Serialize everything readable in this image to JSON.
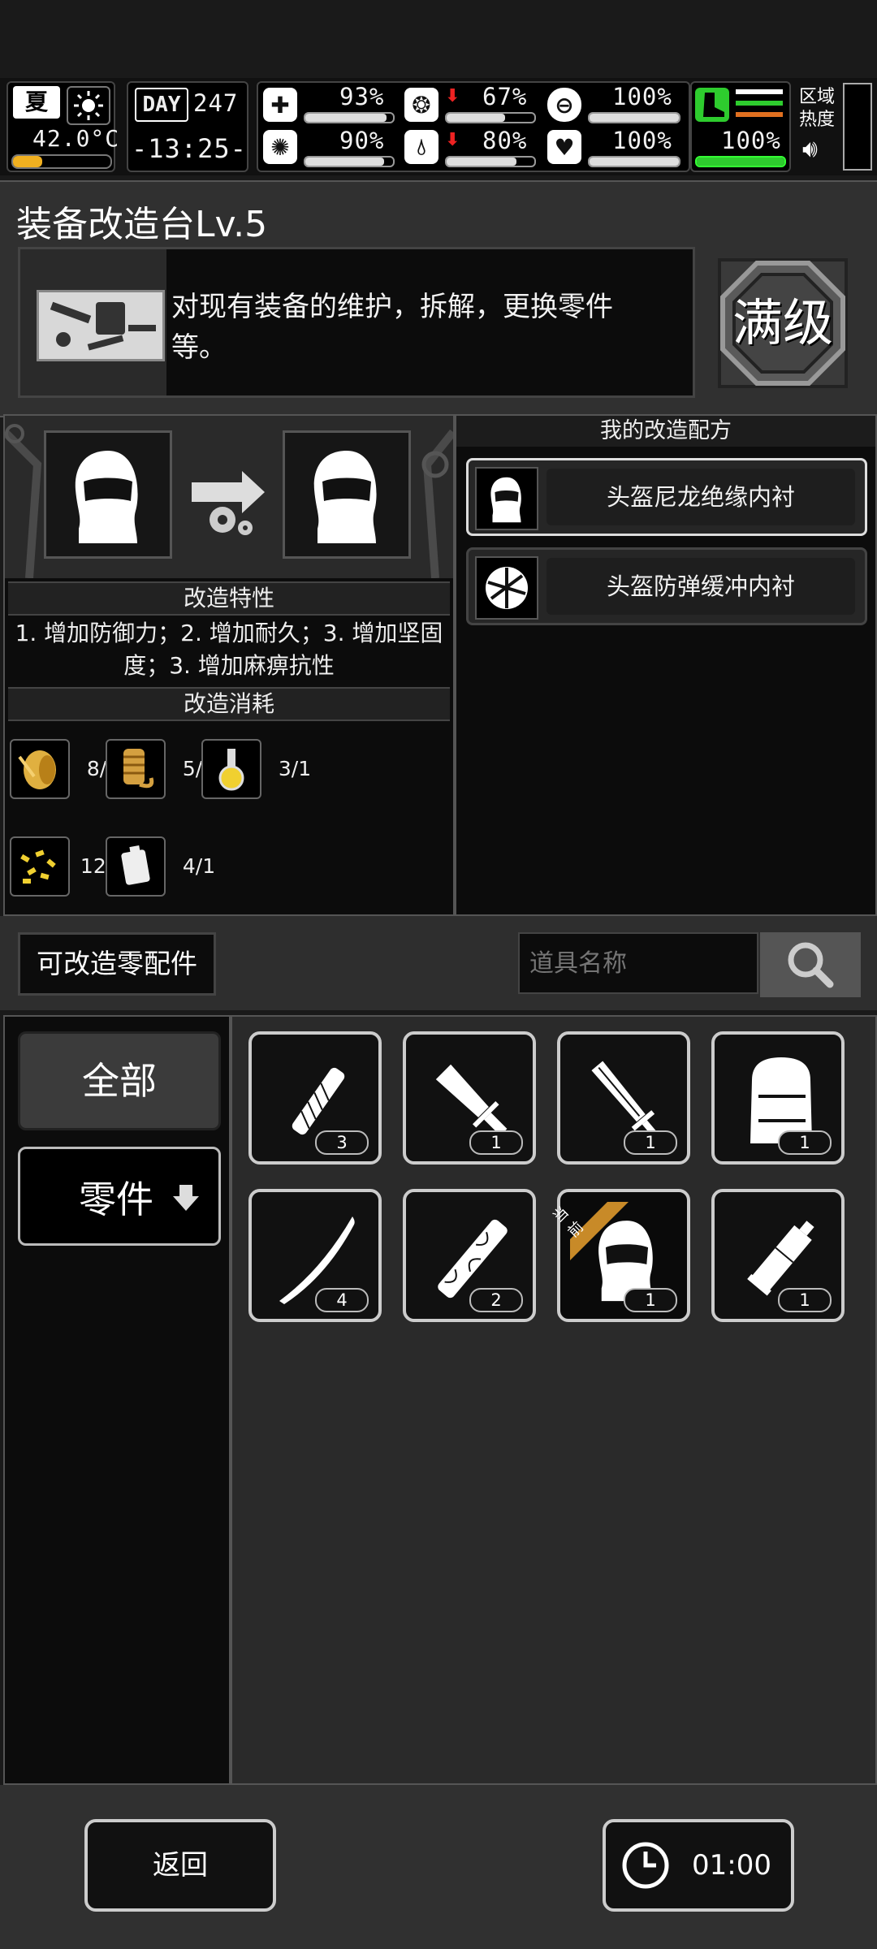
{
  "status": {
    "season": "夏",
    "temperature": "42.0°C",
    "day_label": "DAY",
    "day_number": "247",
    "clock": "-13:25-",
    "stats": [
      {
        "name": "health",
        "value": "93%",
        "level": 0.93,
        "down": false
      },
      {
        "name": "stomach",
        "value": "67%",
        "level": 0.67,
        "down": true
      },
      {
        "name": "helmet",
        "value": "100%",
        "level": 1.0,
        "down": false
      },
      {
        "name": "brain",
        "value": "90%",
        "level": 0.9,
        "down": false
      },
      {
        "name": "water",
        "value": "80%",
        "level": 0.8,
        "down": true
      },
      {
        "name": "heart",
        "value": "100%",
        "level": 1.0,
        "down": false
      }
    ],
    "stamina": {
      "value": "100%",
      "level": 1.0
    },
    "zone_label": "区域热度",
    "colors": {
      "stamina": "#2ecc2e",
      "warning": "#ee2222",
      "orange": "#e07020"
    }
  },
  "station": {
    "title": "装备改造台Lv.5",
    "description": "对现有装备的维护，拆解，更换零件等。",
    "max_level": "满级"
  },
  "mod": {
    "props_title": "改造特性",
    "props_text": "1. 增加防御力；2. 增加耐久；3. 增加坚固度；3. 增加麻痹抗性",
    "cost_title": "改造消耗",
    "materials": [
      {
        "icon": "wire-spool-icon",
        "count": "8/1"
      },
      {
        "icon": "rope-coil-icon",
        "count": "5/1"
      },
      {
        "icon": "chemical-flask-icon",
        "count": "3/1"
      },
      {
        "icon": "gold-nuggets-icon",
        "count": "12/1"
      },
      {
        "icon": "battery-icon",
        "count": "4/1"
      }
    ]
  },
  "recipes": {
    "title": "我的改造配方",
    "items": [
      {
        "label": "头盔尼龙绝缘内衬",
        "icon": "balaclava-icon",
        "selected": true
      },
      {
        "label": "头盔防弹缓冲内衬",
        "icon": "padded-lining-icon",
        "selected": false
      }
    ]
  },
  "parts": {
    "label": "可改造零配件",
    "search_placeholder": "道具名称"
  },
  "categories": {
    "all": "全部",
    "parts": "零件"
  },
  "inventory": [
    {
      "icon": "wrapped-handle-icon",
      "qty": "3"
    },
    {
      "icon": "machete-icon",
      "qty": "1"
    },
    {
      "icon": "serrated-blade-icon",
      "qty": "1"
    },
    {
      "icon": "backpack-icon",
      "qty": "1"
    },
    {
      "icon": "katana-blade-icon",
      "qty": "4"
    },
    {
      "icon": "ornate-handle-icon",
      "qty": "2"
    },
    {
      "icon": "balaclava-icon",
      "qty": "1",
      "tag": "当前"
    },
    {
      "icon": "glue-tube-icon",
      "qty": "1"
    }
  ],
  "footer": {
    "back_label": "返回",
    "timer": "01:00"
  }
}
